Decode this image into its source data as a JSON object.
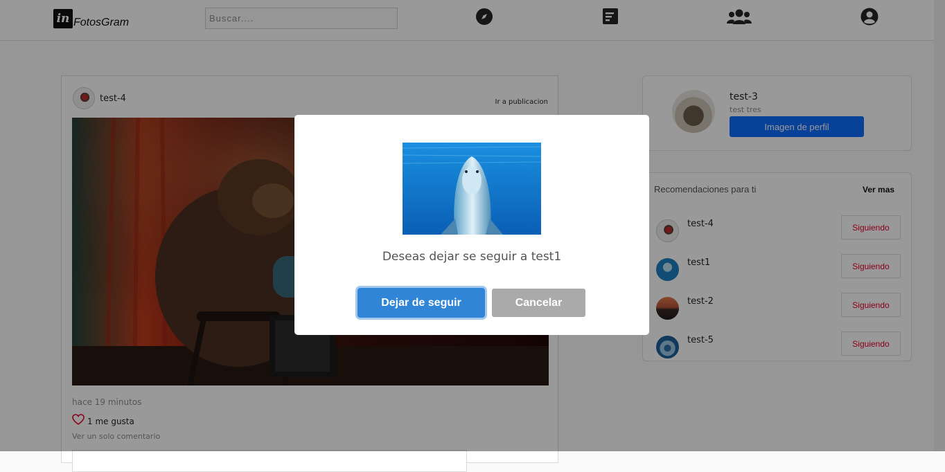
{
  "navbar": {
    "logo_mark": "in",
    "logo_text": "FotosGram",
    "search_placeholder": "Buscar....",
    "icons": [
      "compass-icon",
      "feed-icon",
      "users-icon",
      "profile-icon"
    ]
  },
  "post": {
    "username": "test-4",
    "link_label": "Ir a publicacion",
    "time": "hace 19 minutos",
    "likes": "1 me gusta",
    "comments_link": "Ver un solo comentario"
  },
  "profile": {
    "username": "test-3",
    "fullname": "test tres",
    "button_label": "Imagen de perfil"
  },
  "recommendations": {
    "title": "Recomendaciones para ti",
    "more_label": "Ver mas",
    "items": [
      {
        "name": "test-4",
        "button": "Siguiendo"
      },
      {
        "name": "test1",
        "button": "Siguiendo"
      },
      {
        "name": "test-2",
        "button": "Siguiendo"
      },
      {
        "name": "test-5",
        "button": "Siguiendo"
      }
    ]
  },
  "modal": {
    "message": "Deseas dejar se seguir a test1",
    "confirm_label": "Dejar de seguir",
    "cancel_label": "Cancelar"
  },
  "colors": {
    "brand_blue": "#0d6efd",
    "confirm_blue": "#3085d6",
    "cancel_gray": "#aaaaaa",
    "following_red": "#e4002b"
  }
}
